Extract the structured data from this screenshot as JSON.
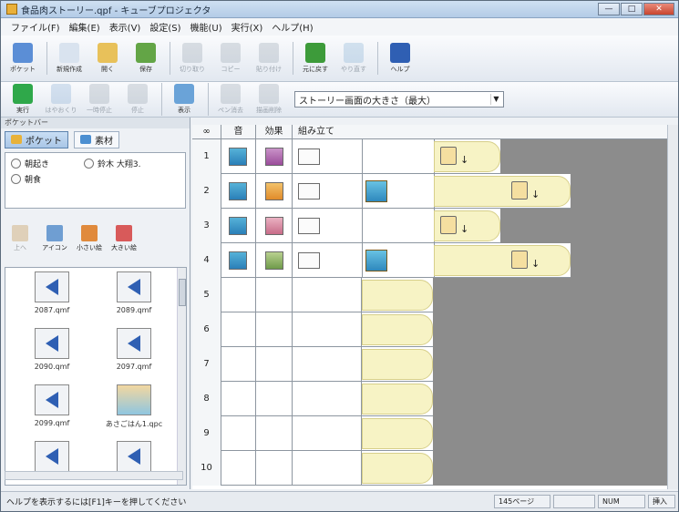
{
  "window": {
    "title": "食品肉ストーリー.qpf - キューブプロジェクタ",
    "buttons": [
      "—",
      "□",
      "✕"
    ]
  },
  "menu": [
    "ファイル(F)",
    "編集(E)",
    "表示(V)",
    "設定(S)",
    "機能(U)",
    "実行(X)",
    "ヘルプ(H)"
  ],
  "toolbar1": [
    {
      "label": "ポケット",
      "icon": "pocket-icon",
      "color": "#5b8ed6",
      "enabled": true
    },
    {
      "label": "新規作成",
      "icon": "new-file-icon",
      "color": "#d9e3ef",
      "enabled": true
    },
    {
      "label": "開く",
      "icon": "open-folder-icon",
      "color": "#e8c15a",
      "enabled": true
    },
    {
      "label": "保存",
      "icon": "save-icon",
      "color": "#63a546",
      "enabled": true
    },
    {
      "label": "切り取り",
      "icon": "cut-icon",
      "color": "#9fa9b4",
      "enabled": false
    },
    {
      "label": "コピー",
      "icon": "copy-icon",
      "color": "#9fa9b4",
      "enabled": false
    },
    {
      "label": "貼り付け",
      "icon": "paste-icon",
      "color": "#9fa9b4",
      "enabled": false
    },
    {
      "label": "元に戻す",
      "icon": "undo-icon",
      "color": "#3d9b3a",
      "enabled": true
    },
    {
      "label": "やり直す",
      "icon": "redo-icon",
      "color": "#8db5d6",
      "enabled": false
    },
    {
      "label": "ヘルプ",
      "icon": "help-icon",
      "color": "#2f5fb3",
      "enabled": true
    }
  ],
  "toolbar2": [
    {
      "label": "実行",
      "icon": "play-icon",
      "color": "#2fa84a",
      "enabled": true
    },
    {
      "label": "はやおくり",
      "icon": "fast-forward-icon",
      "color": "#8fb2d6",
      "enabled": false
    },
    {
      "label": "一時停止",
      "icon": "pause-icon",
      "color": "#9fa9b4",
      "enabled": false
    },
    {
      "label": "停止",
      "icon": "stop-icon",
      "color": "#9fa9b4",
      "enabled": false
    },
    {
      "label": "表示",
      "icon": "display-icon",
      "color": "#6aa3d8",
      "enabled": true
    },
    {
      "label": "ペン消去",
      "icon": "pen-erase-icon",
      "color": "#9fa9b4",
      "enabled": false
    },
    {
      "label": "描画削除",
      "icon": "drawing-delete-icon",
      "color": "#9fa9b4",
      "enabled": false
    }
  ],
  "combo": {
    "value": "ストーリー画面の大きさ（最大）"
  },
  "leftPanel": {
    "caption": "ポケットバー",
    "tabs": [
      {
        "label": "ポケット",
        "active": true,
        "color": "#e8b23a"
      },
      {
        "label": "素材",
        "active": false,
        "color": "#4c8fd1"
      }
    ],
    "characters": [
      "朝起き",
      "鈴木 大翔3.",
      "朝食"
    ],
    "viewButtons": [
      {
        "label": "上へ",
        "enabled": false,
        "color": "#c9a060"
      },
      {
        "label": "アイコン",
        "enabled": true,
        "color": "#6f9ed2"
      },
      {
        "label": "小さい絵",
        "enabled": true,
        "color": "#e08a3c"
      },
      {
        "label": "大きい絵",
        "enabled": true,
        "color": "#d85a5a"
      }
    ],
    "thumbnails": [
      "2087.qmf",
      "2089.qmf",
      "2090.qmf",
      "2097.qmf",
      "2099.qmf",
      "あさごはん1.qpc",
      "",
      ""
    ]
  },
  "grid": {
    "headers": [
      "∞",
      "音",
      "効果",
      "組み立て"
    ],
    "rowNumbers": [
      "1",
      "2",
      "3",
      "4",
      "5",
      "6",
      "7",
      "8",
      "9",
      "10"
    ],
    "arrow": "↓"
  },
  "statusbar": {
    "text": "ヘルプを表示するには[F1]キーを押してください",
    "panes": [
      "145ページ",
      "",
      "NUM",
      "挿入"
    ]
  }
}
